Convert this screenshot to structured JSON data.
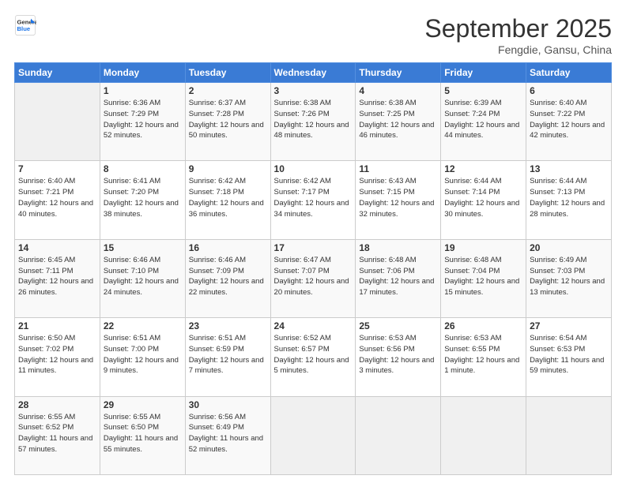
{
  "header": {
    "logo_line1": "General",
    "logo_line2": "Blue",
    "month": "September 2025",
    "location": "Fengdie, Gansu, China"
  },
  "days_of_week": [
    "Sunday",
    "Monday",
    "Tuesday",
    "Wednesday",
    "Thursday",
    "Friday",
    "Saturday"
  ],
  "weeks": [
    [
      {
        "day": "",
        "content": ""
      },
      {
        "day": "1",
        "content": "Sunrise: 6:36 AM\nSunset: 7:29 PM\nDaylight: 12 hours\nand 52 minutes."
      },
      {
        "day": "2",
        "content": "Sunrise: 6:37 AM\nSunset: 7:28 PM\nDaylight: 12 hours\nand 50 minutes."
      },
      {
        "day": "3",
        "content": "Sunrise: 6:38 AM\nSunset: 7:26 PM\nDaylight: 12 hours\nand 48 minutes."
      },
      {
        "day": "4",
        "content": "Sunrise: 6:38 AM\nSunset: 7:25 PM\nDaylight: 12 hours\nand 46 minutes."
      },
      {
        "day": "5",
        "content": "Sunrise: 6:39 AM\nSunset: 7:24 PM\nDaylight: 12 hours\nand 44 minutes."
      },
      {
        "day": "6",
        "content": "Sunrise: 6:40 AM\nSunset: 7:22 PM\nDaylight: 12 hours\nand 42 minutes."
      }
    ],
    [
      {
        "day": "7",
        "content": "Sunrise: 6:40 AM\nSunset: 7:21 PM\nDaylight: 12 hours\nand 40 minutes."
      },
      {
        "day": "8",
        "content": "Sunrise: 6:41 AM\nSunset: 7:20 PM\nDaylight: 12 hours\nand 38 minutes."
      },
      {
        "day": "9",
        "content": "Sunrise: 6:42 AM\nSunset: 7:18 PM\nDaylight: 12 hours\nand 36 minutes."
      },
      {
        "day": "10",
        "content": "Sunrise: 6:42 AM\nSunset: 7:17 PM\nDaylight: 12 hours\nand 34 minutes."
      },
      {
        "day": "11",
        "content": "Sunrise: 6:43 AM\nSunset: 7:15 PM\nDaylight: 12 hours\nand 32 minutes."
      },
      {
        "day": "12",
        "content": "Sunrise: 6:44 AM\nSunset: 7:14 PM\nDaylight: 12 hours\nand 30 minutes."
      },
      {
        "day": "13",
        "content": "Sunrise: 6:44 AM\nSunset: 7:13 PM\nDaylight: 12 hours\nand 28 minutes."
      }
    ],
    [
      {
        "day": "14",
        "content": "Sunrise: 6:45 AM\nSunset: 7:11 PM\nDaylight: 12 hours\nand 26 minutes."
      },
      {
        "day": "15",
        "content": "Sunrise: 6:46 AM\nSunset: 7:10 PM\nDaylight: 12 hours\nand 24 minutes."
      },
      {
        "day": "16",
        "content": "Sunrise: 6:46 AM\nSunset: 7:09 PM\nDaylight: 12 hours\nand 22 minutes."
      },
      {
        "day": "17",
        "content": "Sunrise: 6:47 AM\nSunset: 7:07 PM\nDaylight: 12 hours\nand 20 minutes."
      },
      {
        "day": "18",
        "content": "Sunrise: 6:48 AM\nSunset: 7:06 PM\nDaylight: 12 hours\nand 17 minutes."
      },
      {
        "day": "19",
        "content": "Sunrise: 6:48 AM\nSunset: 7:04 PM\nDaylight: 12 hours\nand 15 minutes."
      },
      {
        "day": "20",
        "content": "Sunrise: 6:49 AM\nSunset: 7:03 PM\nDaylight: 12 hours\nand 13 minutes."
      }
    ],
    [
      {
        "day": "21",
        "content": "Sunrise: 6:50 AM\nSunset: 7:02 PM\nDaylight: 12 hours\nand 11 minutes."
      },
      {
        "day": "22",
        "content": "Sunrise: 6:51 AM\nSunset: 7:00 PM\nDaylight: 12 hours\nand 9 minutes."
      },
      {
        "day": "23",
        "content": "Sunrise: 6:51 AM\nSunset: 6:59 PM\nDaylight: 12 hours\nand 7 minutes."
      },
      {
        "day": "24",
        "content": "Sunrise: 6:52 AM\nSunset: 6:57 PM\nDaylight: 12 hours\nand 5 minutes."
      },
      {
        "day": "25",
        "content": "Sunrise: 6:53 AM\nSunset: 6:56 PM\nDaylight: 12 hours\nand 3 minutes."
      },
      {
        "day": "26",
        "content": "Sunrise: 6:53 AM\nSunset: 6:55 PM\nDaylight: 12 hours\nand 1 minute."
      },
      {
        "day": "27",
        "content": "Sunrise: 6:54 AM\nSunset: 6:53 PM\nDaylight: 11 hours\nand 59 minutes."
      }
    ],
    [
      {
        "day": "28",
        "content": "Sunrise: 6:55 AM\nSunset: 6:52 PM\nDaylight: 11 hours\nand 57 minutes."
      },
      {
        "day": "29",
        "content": "Sunrise: 6:55 AM\nSunset: 6:50 PM\nDaylight: 11 hours\nand 55 minutes."
      },
      {
        "day": "30",
        "content": "Sunrise: 6:56 AM\nSunset: 6:49 PM\nDaylight: 11 hours\nand 52 minutes."
      },
      {
        "day": "",
        "content": ""
      },
      {
        "day": "",
        "content": ""
      },
      {
        "day": "",
        "content": ""
      },
      {
        "day": "",
        "content": ""
      }
    ]
  ]
}
